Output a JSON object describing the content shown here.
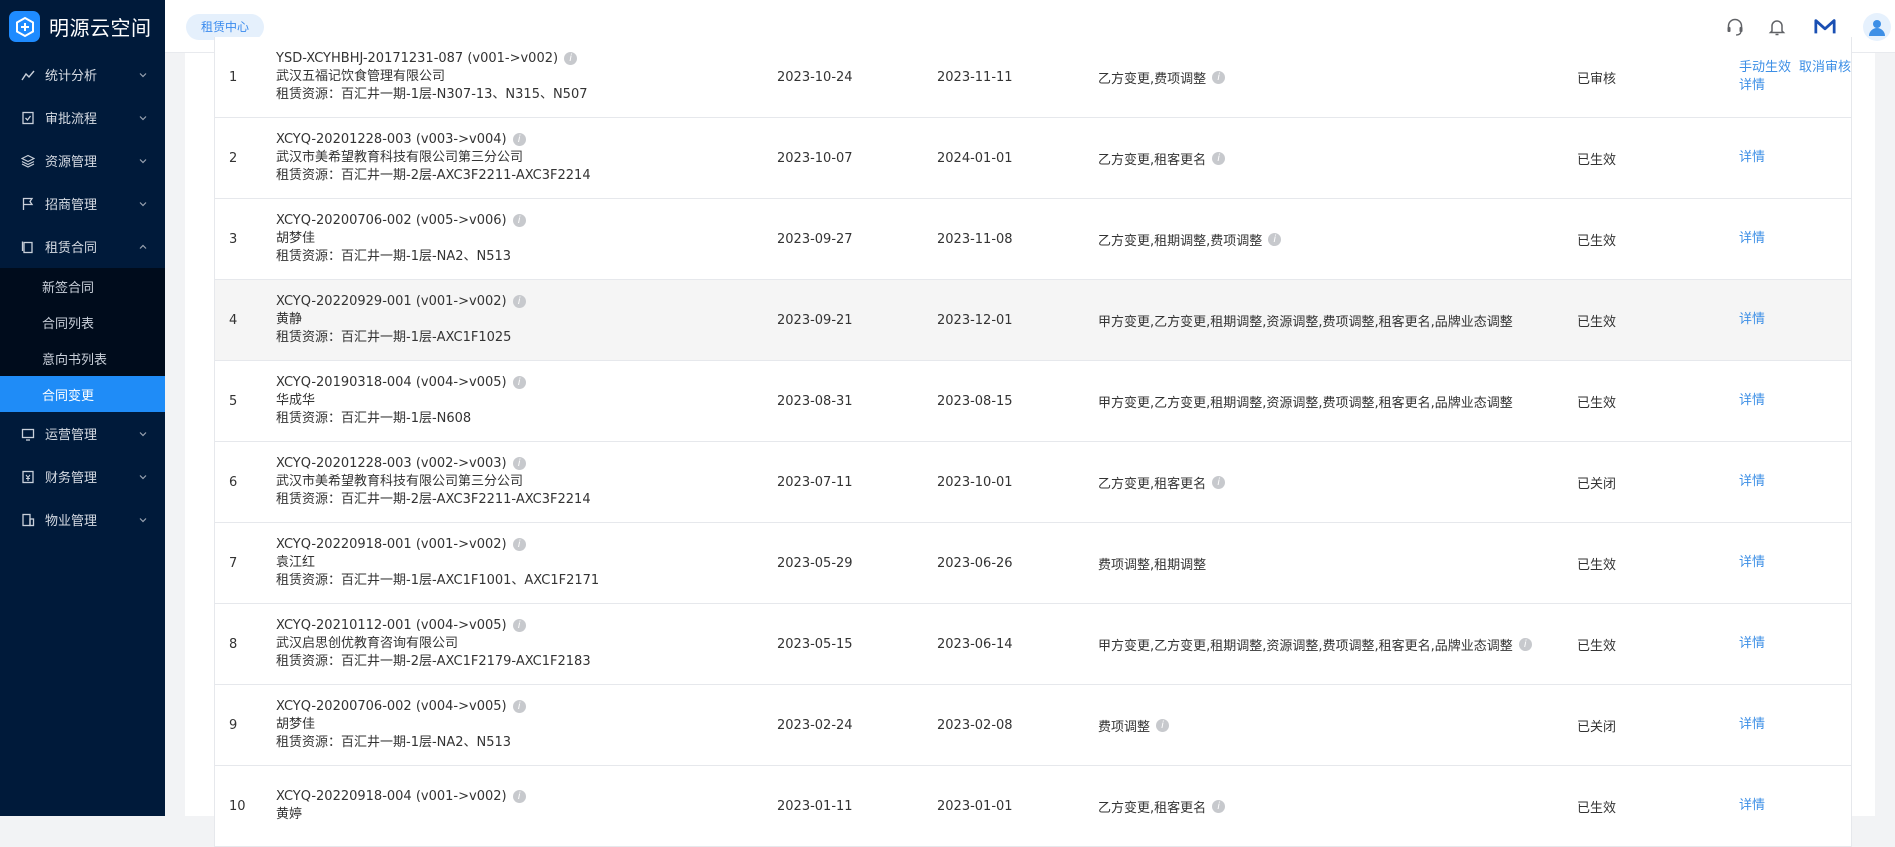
{
  "app": {
    "title": "明源云空间"
  },
  "sidebar": {
    "items": [
      {
        "label": "统计分析",
        "icon": "chart-icon"
      },
      {
        "label": "审批流程",
        "icon": "approval-icon"
      },
      {
        "label": "资源管理",
        "icon": "layers-icon"
      },
      {
        "label": "招商管理",
        "icon": "flag-icon"
      },
      {
        "label": "租赁合同",
        "icon": "contract-icon"
      },
      {
        "label": "运营管理",
        "icon": "operation-icon"
      },
      {
        "label": "财务管理",
        "icon": "finance-icon"
      },
      {
        "label": "物业管理",
        "icon": "building-icon"
      }
    ],
    "sub_items": [
      "新签合同",
      "合同列表",
      "意向书列表",
      "合同变更"
    ],
    "active_sub": "合同变更"
  },
  "header": {
    "tag": "租赁中心"
  },
  "table": {
    "rows": [
      {
        "idx": "1",
        "code": "YSD-XCYHBHJ-20171231-087 (v001->v002)",
        "tenant": "武汉五福记饮食管理有限公司",
        "resource": "租赁资源：百汇井一期-1层-N307-13、N315、N507",
        "start": "2023-10-24",
        "end": "2023-11-11",
        "type": "乙方变更,费项调整",
        "type_info": true,
        "status": "已审核",
        "ops": [
          "手动生效",
          "取消审核",
          "详情"
        ]
      },
      {
        "idx": "2",
        "code": "XCYQ-20201228-003 (v003->v004)",
        "tenant": "武汉市美希望教育科技有限公司第三分公司",
        "resource": "租赁资源：百汇井一期-2层-AXC3F2211-AXC3F2214",
        "start": "2023-10-07",
        "end": "2024-01-01",
        "type": "乙方变更,租客更名",
        "type_info": true,
        "status": "已生效",
        "ops": [
          "详情"
        ]
      },
      {
        "idx": "3",
        "code": "XCYQ-20200706-002 (v005->v006)",
        "tenant": "胡梦佳",
        "resource": "租赁资源：百汇井一期-1层-NA2、N513",
        "start": "2023-09-27",
        "end": "2023-11-08",
        "type": "乙方变更,租期调整,费项调整",
        "type_info": true,
        "status": "已生效",
        "ops": [
          "详情"
        ]
      },
      {
        "idx": "4",
        "code": "XCYQ-20220929-001 (v001->v002)",
        "tenant": "黄静",
        "resource": "租赁资源：百汇井一期-1层-AXC1F1025",
        "start": "2023-09-21",
        "end": "2023-12-01",
        "type": "甲方变更,乙方变更,租期调整,资源调整,费项调整,租客更名,品牌业态调整",
        "type_info": false,
        "status": "已生效",
        "ops": [
          "详情"
        ]
      },
      {
        "idx": "5",
        "code": "XCYQ-20190318-004 (v004->v005)",
        "tenant": "华成华",
        "resource": "租赁资源：百汇井一期-1层-N608",
        "start": "2023-08-31",
        "end": "2023-08-15",
        "type": "甲方变更,乙方变更,租期调整,资源调整,费项调整,租客更名,品牌业态调整",
        "type_info": false,
        "status": "已生效",
        "ops": [
          "详情"
        ]
      },
      {
        "idx": "6",
        "code": "XCYQ-20201228-003 (v002->v003)",
        "tenant": "武汉市美希望教育科技有限公司第三分公司",
        "resource": "租赁资源：百汇井一期-2层-AXC3F2211-AXC3F2214",
        "start": "2023-07-11",
        "end": "2023-10-01",
        "type": "乙方变更,租客更名",
        "type_info": true,
        "status": "已关闭",
        "ops": [
          "详情"
        ]
      },
      {
        "idx": "7",
        "code": "XCYQ-20220918-001 (v001->v002)",
        "tenant": "袁江红",
        "resource": "租赁资源：百汇井一期-1层-AXC1F1001、AXC1F2171",
        "start": "2023-05-29",
        "end": "2023-06-26",
        "type": "费项调整,租期调整",
        "type_info": false,
        "status": "已生效",
        "ops": [
          "详情"
        ]
      },
      {
        "idx": "8",
        "code": "XCYQ-20210112-001 (v004->v005)",
        "tenant": "武汉启思创优教育咨询有限公司",
        "resource": "租赁资源：百汇井一期-2层-AXC1F2179-AXC1F2183",
        "start": "2023-05-15",
        "end": "2023-06-14",
        "type": "甲方变更,乙方变更,租期调整,资源调整,费项调整,租客更名,品牌业态调整",
        "type_info": true,
        "status": "已生效",
        "ops": [
          "详情"
        ]
      },
      {
        "idx": "9",
        "code": "XCYQ-20200706-002 (v004->v005)",
        "tenant": "胡梦佳",
        "resource": "租赁资源：百汇井一期-1层-NA2、N513",
        "start": "2023-02-24",
        "end": "2023-02-08",
        "type": "费项调整",
        "type_info": true,
        "status": "已关闭",
        "ops": [
          "详情"
        ]
      },
      {
        "idx": "10",
        "code": "XCYQ-20220918-004 (v001->v002)",
        "tenant": "黄婷",
        "resource": "",
        "start": "2023-01-11",
        "end": "2023-01-01",
        "type": "乙方变更,租客更名",
        "type_info": true,
        "status": "已生效",
        "ops": [
          "详情"
        ]
      }
    ]
  }
}
